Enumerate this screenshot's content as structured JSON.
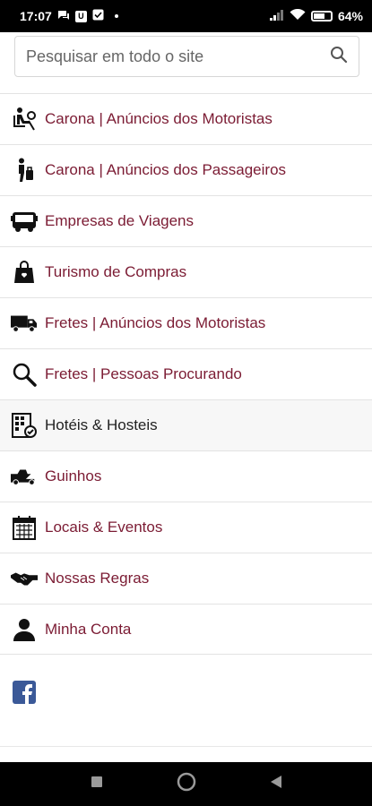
{
  "status_bar": {
    "time": "17:07",
    "u_badge": "U",
    "battery_percent": "64"
  },
  "search": {
    "placeholder": "Pesquisar em todo o site",
    "value": ""
  },
  "menu": {
    "items": [
      {
        "label": "Carona | Anúncios dos Motoristas",
        "icon": "driver-seat-icon"
      },
      {
        "label": "Carona | Anúncios dos Passageiros",
        "icon": "passenger-luggage-icon"
      },
      {
        "label": "Empresas de Viagens",
        "icon": "bus-icon"
      },
      {
        "label": "Turismo de Compras",
        "icon": "shopping-bag-icon"
      },
      {
        "label": "Fretes | Anúncios dos Motoristas",
        "icon": "truck-icon"
      },
      {
        "label": "Fretes | Pessoas Procurando",
        "icon": "magnifier-icon"
      },
      {
        "label": "Hotéis & Hosteis",
        "icon": "hotel-building-icon"
      },
      {
        "label": "Guinhos",
        "icon": "tow-truck-icon"
      },
      {
        "label": "Locais & Eventos",
        "icon": "calendar-icon"
      },
      {
        "label": "Nossas Regras",
        "icon": "handshake-icon"
      },
      {
        "label": "Minha Conta",
        "icon": "user-icon"
      }
    ]
  },
  "social": {
    "facebook_icon": "facebook-icon"
  },
  "colors": {
    "link": "#7b1b33",
    "text_dark": "#222222",
    "facebook": "#3b5998"
  }
}
